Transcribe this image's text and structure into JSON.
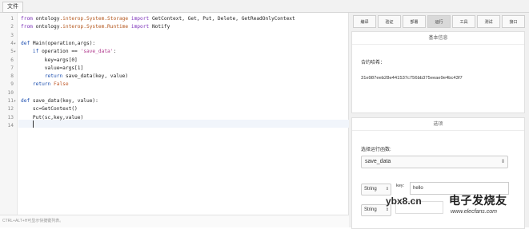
{
  "menu": {
    "file": "文件"
  },
  "editor": {
    "lines": [
      {
        "n": "1",
        "fold": "",
        "parts": [
          {
            "c": "kw",
            "t": "from"
          },
          {
            "c": "",
            "t": " ontology"
          },
          {
            "c": "mod",
            "t": ".interop.System.Storage"
          },
          {
            "c": "",
            "t": " "
          },
          {
            "c": "kw",
            "t": "import"
          },
          {
            "c": "",
            "t": " GetContext, Get, Put, Delete, GetReadOnlyContext"
          }
        ]
      },
      {
        "n": "2",
        "fold": "",
        "parts": [
          {
            "c": "kw",
            "t": "from"
          },
          {
            "c": "",
            "t": " ontology"
          },
          {
            "c": "mod",
            "t": ".interop.System.Runtime"
          },
          {
            "c": "",
            "t": " "
          },
          {
            "c": "kw",
            "t": "import"
          },
          {
            "c": "",
            "t": " Notify"
          }
        ]
      },
      {
        "n": "3",
        "fold": "",
        "parts": []
      },
      {
        "n": "4",
        "fold": "▾",
        "parts": [
          {
            "c": "kb",
            "t": "def"
          },
          {
            "c": "",
            "t": " Main(operation,args):"
          }
        ]
      },
      {
        "n": "5",
        "fold": "▾",
        "parts": [
          {
            "c": "",
            "t": "    "
          },
          {
            "c": "kb",
            "t": "if"
          },
          {
            "c": "",
            "t": " operation == "
          },
          {
            "c": "str",
            "t": "'save_data'"
          },
          {
            "c": "",
            "t": ":"
          }
        ]
      },
      {
        "n": "6",
        "fold": "",
        "parts": [
          {
            "c": "",
            "t": "        key=args[0]"
          }
        ]
      },
      {
        "n": "7",
        "fold": "",
        "parts": [
          {
            "c": "",
            "t": "        value=args[1]"
          }
        ]
      },
      {
        "n": "8",
        "fold": "",
        "parts": [
          {
            "c": "",
            "t": "        "
          },
          {
            "c": "kb",
            "t": "return"
          },
          {
            "c": "",
            "t": " save_data(key, value)"
          }
        ]
      },
      {
        "n": "9",
        "fold": "",
        "parts": [
          {
            "c": "",
            "t": "    "
          },
          {
            "c": "kb",
            "t": "return"
          },
          {
            "c": "",
            "t": " "
          },
          {
            "c": "fal",
            "t": "False"
          }
        ]
      },
      {
        "n": "10",
        "fold": "",
        "parts": []
      },
      {
        "n": "11",
        "fold": "▾",
        "parts": [
          {
            "c": "kb",
            "t": "def"
          },
          {
            "c": "",
            "t": " save_data(key, value):"
          }
        ]
      },
      {
        "n": "12",
        "fold": "",
        "parts": [
          {
            "c": "",
            "t": "    sc=GetContext()"
          }
        ]
      },
      {
        "n": "13",
        "fold": "",
        "parts": [
          {
            "c": "",
            "t": "    Put(sc,key,value)"
          }
        ]
      },
      {
        "n": "14",
        "fold": "",
        "parts": []
      }
    ],
    "status": "CTRL+ALT+H可显示快捷键列表。"
  },
  "tabs": [
    {
      "label": "编译",
      "active": false
    },
    {
      "label": "验证",
      "active": false
    },
    {
      "label": "部署",
      "active": false
    },
    {
      "label": "运行",
      "active": true
    },
    {
      "label": "工具",
      "active": false
    },
    {
      "label": "测试",
      "active": false
    },
    {
      "label": "接口",
      "active": false
    }
  ],
  "basic_info": {
    "title": "基本信息",
    "hash_label": "合约哈希：",
    "hash_value": "31e987eeb28e441537c756bb375eeae9e4bc43f7"
  },
  "options": {
    "title": "选项",
    "function_label": "选择运行函数:",
    "function_value": "save_data",
    "params": [
      {
        "type": "String",
        "label": "key:",
        "value": "hello"
      },
      {
        "type": "String",
        "label": "",
        "value": ""
      }
    ]
  },
  "watermark": {
    "url": "ybx8.cn",
    "cn_text": "电子发烧友",
    "domain": "www.elecfans.com"
  }
}
